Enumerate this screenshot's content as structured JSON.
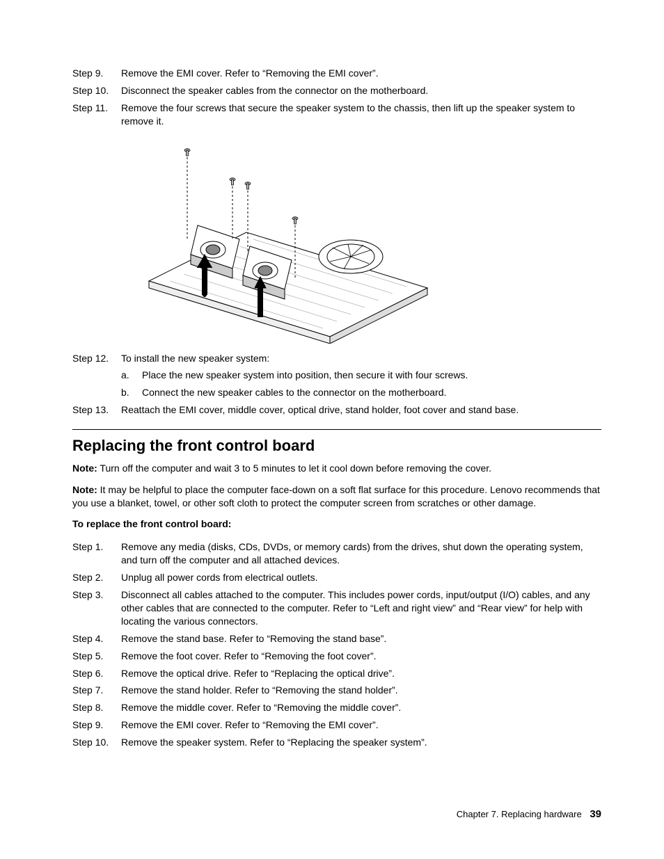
{
  "steps_top": [
    {
      "label": "Step 9.",
      "text": "Remove the EMI cover. Refer to “Removing the EMI cover”."
    },
    {
      "label": "Step 10.",
      "text": "Disconnect the speaker cables from the connector on the motherboard."
    },
    {
      "label": "Step 11.",
      "text": "Remove the four screws that secure the speaker system to the chassis, then lift up the speaker system to remove it."
    }
  ],
  "step12": {
    "label": "Step 12.",
    "text": "To install the new speaker system:",
    "subs": [
      {
        "label": "a.",
        "text": "Place the new speaker system into position, then secure it with four screws."
      },
      {
        "label": "b.",
        "text": "Connect the new speaker cables to the connector on the motherboard."
      }
    ]
  },
  "step13": {
    "label": "Step 13.",
    "text": "Reattach the EMI cover, middle cover, optical drive, stand holder, foot cover and stand base."
  },
  "section_heading": "Replacing the front control board",
  "note1_label": "Note:",
  "note1_text": " Turn off the computer and wait 3 to 5 minutes to let it cool down before removing the cover.",
  "note2_label": "Note:",
  "note2_text": " It may be helpful to place the computer face-down on a soft flat surface for this procedure. Lenovo recommends that you use a blanket, towel, or other soft cloth to protect the computer screen from scratches or other damage.",
  "procedure_heading": "To replace the front control board:",
  "steps_bottom": [
    {
      "label": "Step 1.",
      "text": "Remove any media (disks, CDs, DVDs, or memory cards) from the drives, shut down the operating system, and turn off the computer and all attached devices."
    },
    {
      "label": "Step 2.",
      "text": "Unplug all power cords from electrical outlets."
    },
    {
      "label": "Step 3.",
      "text": "Disconnect all cables attached to the computer. This includes power cords, input/output (I/O) cables, and any other cables that are connected to the computer. Refer to “Left and right view” and “Rear view” for help with locating the various connectors."
    },
    {
      "label": "Step 4.",
      "text": "Remove the stand base. Refer to “Removing the stand base”."
    },
    {
      "label": "Step 5.",
      "text": "Remove the foot cover. Refer to “Removing the foot cover”."
    },
    {
      "label": "Step 6.",
      "text": "Remove the optical drive. Refer to “Replacing the optical drive”."
    },
    {
      "label": "Step 7.",
      "text": "Remove the stand holder. Refer to “Removing the stand holder”."
    },
    {
      "label": "Step 8.",
      "text": "Remove the middle cover. Refer to “Removing the middle cover”."
    },
    {
      "label": "Step 9.",
      "text": "Remove the EMI cover. Refer to “Removing the EMI cover”."
    },
    {
      "label": "Step 10.",
      "text": "Remove the speaker system. Refer to “Replacing the speaker system”."
    }
  ],
  "footer_chapter": "Chapter 7. Replacing hardware",
  "footer_page": "39"
}
